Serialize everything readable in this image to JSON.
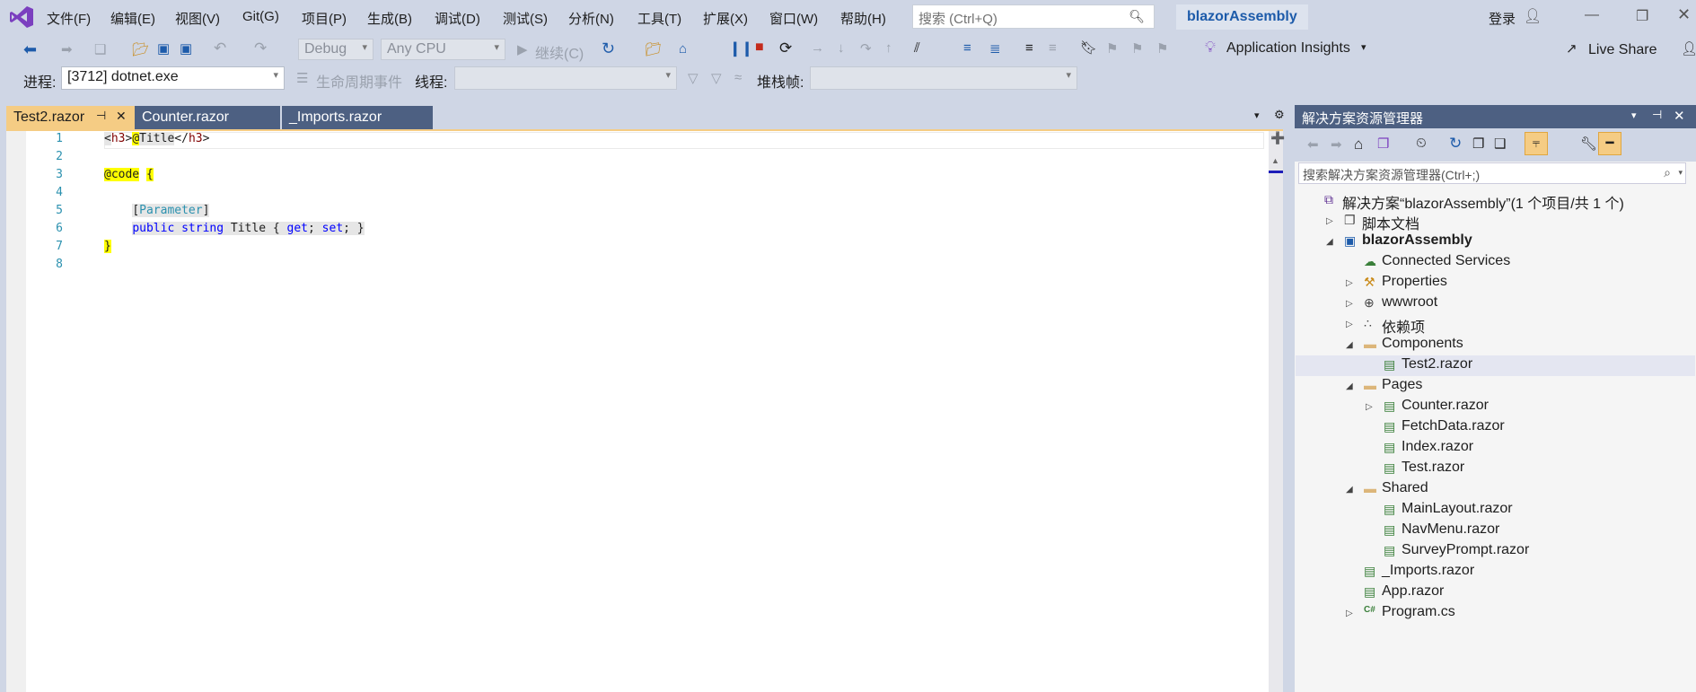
{
  "menu": [
    "文件(F)",
    "编辑(E)",
    "视图(V)",
    "Git(G)",
    "项目(P)",
    "生成(B)",
    "调试(D)",
    "测试(S)",
    "分析(N)",
    "工具(T)",
    "扩展(X)",
    "窗口(W)",
    "帮助(H)"
  ],
  "search": {
    "placeholder": "搜索 (Ctrl+Q)"
  },
  "solution_name": "blazorAssembly",
  "login": "登录",
  "toolbar": {
    "config": "Debug",
    "platform": "Any CPU",
    "continue": "继续(C)",
    "app_insights": "Application Insights",
    "live_share": "Live Share"
  },
  "debugbar": {
    "process_label": "进程:",
    "process_value": "[3712] dotnet.exe",
    "lifecycle": "生命周期事件",
    "thread_label": "线程:",
    "stack_label": "堆栈帧:"
  },
  "tabs": [
    {
      "label": "Test2.razor",
      "active": true
    },
    {
      "label": "Counter.razor",
      "active": false
    },
    {
      "label": "_Imports.razor",
      "active": false
    }
  ],
  "editor": {
    "line_numbers": [
      "1",
      "2",
      "3",
      "4",
      "5",
      "6",
      "7",
      "8"
    ],
    "lines": [
      "<h3>@Title</h3>",
      "",
      "@code {",
      "",
      "    [Parameter]",
      "    public string Title { get; set; }",
      "}",
      ""
    ]
  },
  "solution_explorer": {
    "title": "解决方案资源管理器",
    "search_placeholder": "搜索解决方案资源管理器(Ctrl+;)",
    "items": [
      {
        "label": "解决方案“blazorAssembly”(1 个项目/共 1 个)",
        "icon": "solution-icon"
      },
      {
        "label": "脚本文档",
        "icon": "script-docs-icon"
      },
      {
        "label": "blazorAssembly",
        "icon": "project-icon"
      },
      {
        "label": "Connected Services",
        "icon": "connected-services-icon"
      },
      {
        "label": "Properties",
        "icon": "properties-icon"
      },
      {
        "label": "wwwroot",
        "icon": "globe-icon"
      },
      {
        "label": "依赖项",
        "icon": "dependencies-icon"
      },
      {
        "label": "Components",
        "icon": "folder-icon"
      },
      {
        "label": "Test2.razor",
        "icon": "razor-file-icon"
      },
      {
        "label": "Pages",
        "icon": "folder-icon"
      },
      {
        "label": "Counter.razor",
        "icon": "razor-file-icon"
      },
      {
        "label": "FetchData.razor",
        "icon": "razor-file-icon"
      },
      {
        "label": "Index.razor",
        "icon": "razor-file-icon"
      },
      {
        "label": "Test.razor",
        "icon": "razor-file-icon"
      },
      {
        "label": "Shared",
        "icon": "folder-icon"
      },
      {
        "label": "MainLayout.razor",
        "icon": "razor-file-icon"
      },
      {
        "label": "NavMenu.razor",
        "icon": "razor-file-icon"
      },
      {
        "label": "SurveyPrompt.razor",
        "icon": "razor-file-icon"
      },
      {
        "label": "_Imports.razor",
        "icon": "razor-file-icon"
      },
      {
        "label": "App.razor",
        "icon": "razor-file-icon"
      },
      {
        "label": "Program.cs",
        "icon": "csharp-file-icon"
      }
    ]
  },
  "colors": {
    "accent": "#f5cc84",
    "panel_header": "#4d6082",
    "chrome": "#cfd6e5"
  }
}
